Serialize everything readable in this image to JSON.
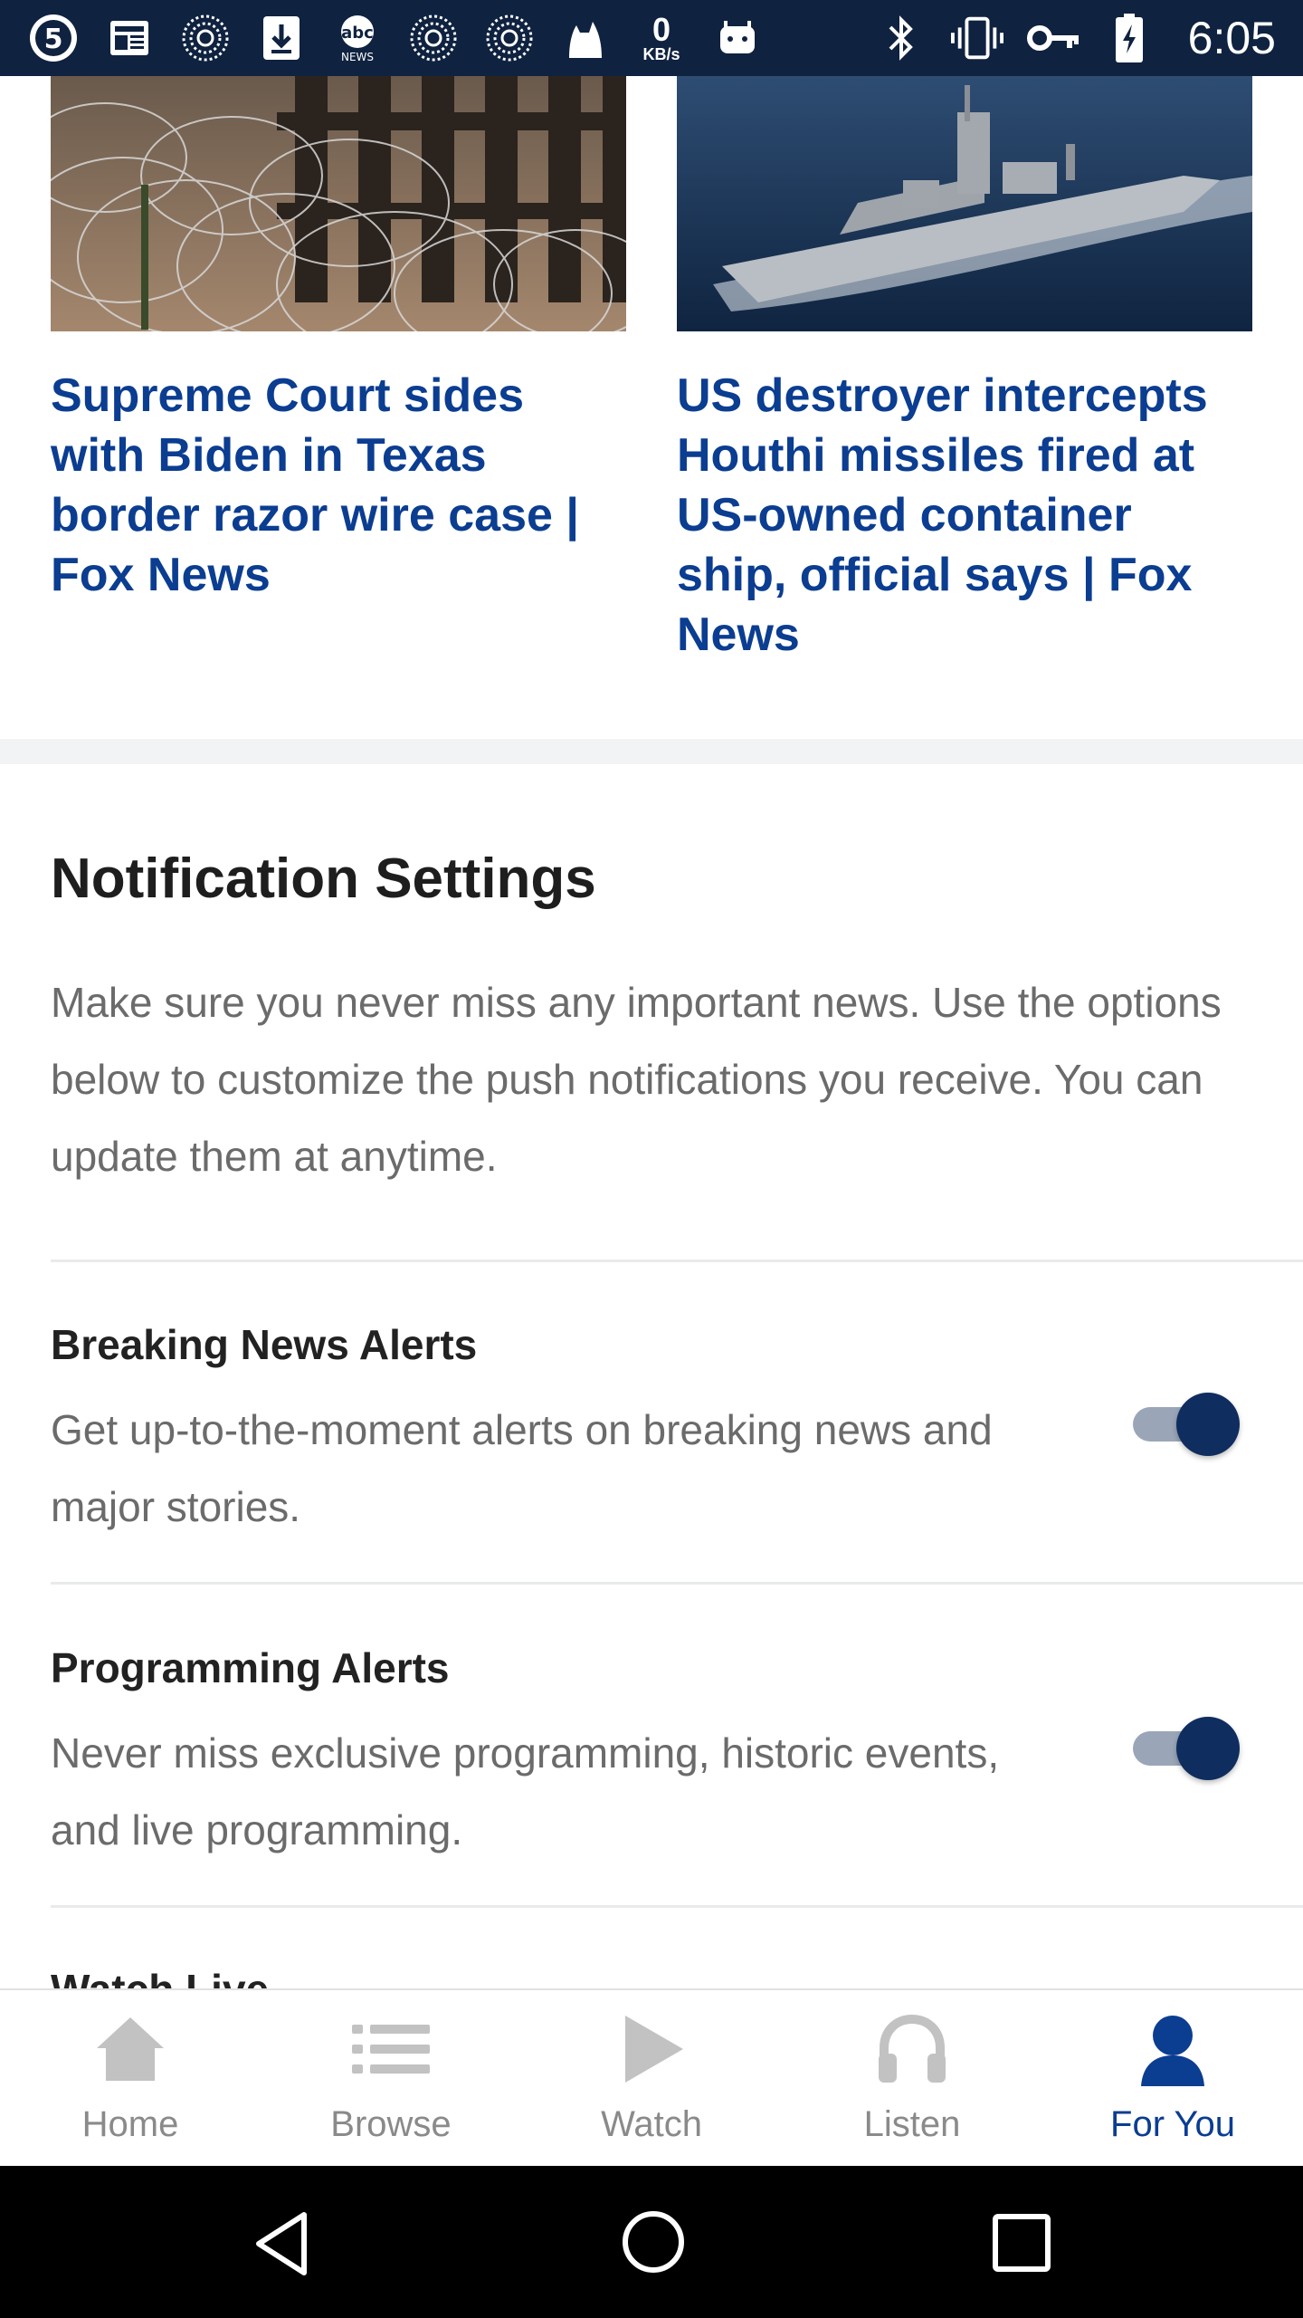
{
  "status_bar": {
    "time": "6:05",
    "data_rate_value": "0",
    "data_rate_unit": "KB/s",
    "left_icons": [
      "channel-5-icon",
      "news-icon",
      "signal-icon",
      "download-icon",
      "abc-news-icon",
      "signal-icon",
      "signal-icon",
      "cat-icon",
      "data-rate-icon",
      "android-icon"
    ],
    "right_icons": [
      "bluetooth-icon",
      "vibrate-icon",
      "key-icon",
      "battery-icon"
    ]
  },
  "articles": [
    {
      "headline": "Supreme Court sides with Biden in Texas border razor wire case | Fox News",
      "image": "razor-wire-photo"
    },
    {
      "headline": "US destroyer intercepts Houthi missiles fired at US-owned container ship, official says | Fox News",
      "image": "destroyer-ship-photo"
    }
  ],
  "notification_settings": {
    "title": "Notification Settings",
    "description": "Make sure you never miss any important news. Use the options below to customize the push notifications you receive. You can update them at anytime.",
    "items": [
      {
        "title": "Breaking News Alerts",
        "description": "Get up-to-the-moment alerts on breaking news and major stories.",
        "enabled": true
      },
      {
        "title": "Programming Alerts",
        "description": "Never miss exclusive programming, historic events, and live programming.",
        "enabled": true
      }
    ],
    "next_item_title_partial": "Watch Live"
  },
  "bottom_nav": {
    "items": [
      {
        "label": "Home",
        "icon": "home-icon"
      },
      {
        "label": "Browse",
        "icon": "list-icon"
      },
      {
        "label": "Watch",
        "icon": "play-icon"
      },
      {
        "label": "Listen",
        "icon": "headphones-icon"
      },
      {
        "label": "For You",
        "icon": "person-icon"
      }
    ],
    "active": "For You"
  },
  "colors": {
    "status_bar_bg": "#0f2240",
    "headline": "#0b3d91",
    "toggle_knob": "#0f2d5f",
    "toggle_track": "#9aa6b8",
    "active_nav": "#0b3d91",
    "inactive_nav": "#8a8a8a"
  }
}
